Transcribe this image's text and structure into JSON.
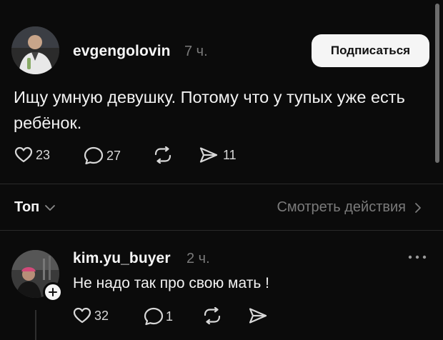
{
  "post": {
    "username": "evgengolovin",
    "time": "7 ч.",
    "follow_label": "Подписаться",
    "text": "Ищу умную девушку. Потому что у тупых уже есть ребёнок.",
    "likes": "23",
    "comments": "27",
    "shares": "11"
  },
  "sort_bar": {
    "label": "Топ",
    "activity_link": "Смотреть действия"
  },
  "reply": {
    "username": "kim.yu_buyer",
    "time": "2 ч.",
    "text": "Не надо так про свою мать !",
    "likes": "32",
    "comments": "1"
  },
  "icons": {
    "like": "heart-icon",
    "comment": "speech-bubble-icon",
    "repost": "repost-icon",
    "share": "send-icon",
    "more": "more-dots-icon",
    "dropdown": "chevron-down-icon",
    "chevron": "chevron-right-icon",
    "add": "plus-icon"
  },
  "colors": {
    "background": "#0b0b0b",
    "text": "#f3f3f3",
    "secondary": "#7a7a7a",
    "button_bg": "#f5f5f5",
    "button_text": "#111111"
  }
}
